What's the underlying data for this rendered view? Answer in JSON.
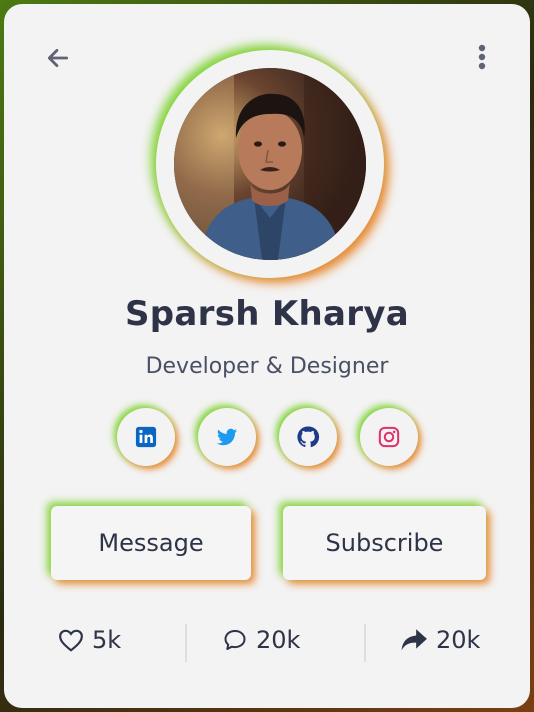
{
  "profile": {
    "name": "Sparsh Kharya",
    "role": "Developer & Designer"
  },
  "socials": [
    {
      "icon": "linkedin-icon",
      "color": "#0a66c2"
    },
    {
      "icon": "twitter-icon",
      "color": "#1d9bf0"
    },
    {
      "icon": "github-icon",
      "color": "#1f3a8a"
    },
    {
      "icon": "instagram-icon",
      "color": "#e1306c"
    }
  ],
  "actions": {
    "message_label": "Message",
    "subscribe_label": "Subscribe"
  },
  "stats": {
    "likes": "5k",
    "comments": "20k",
    "shares": "20k"
  },
  "colors": {
    "card_background": "#f3f3f3",
    "text_primary": "#2f3348",
    "glow_green": "#78d228",
    "glow_orange": "#e88228"
  }
}
